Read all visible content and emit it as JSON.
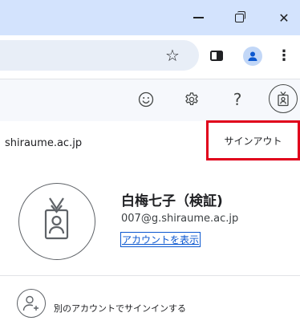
{
  "window": {
    "minimize_icon": "minimize-icon",
    "restore_icon": "restore-icon",
    "close_glyph": "✕"
  },
  "toolbar": {
    "star_glyph": "☆",
    "sidepanel_icon": "side-panel-icon",
    "profile_icon": "profile-icon",
    "menu_glyph": "⋮"
  },
  "gmail_header": {
    "emoji_icon": "emoji-icon",
    "settings_icon": "gear-icon",
    "help_glyph": "?",
    "badge_icon": "id-badge-icon"
  },
  "account": {
    "domain": "shiraume.ac.jp",
    "sign_out_label": "サインアウト",
    "name": "白梅七子（検証)",
    "email": "007@g.shiraume.ac.jp",
    "view_account_label": "アカウントを表示",
    "add_account_label": "別のアカウントでサインインする"
  },
  "colors": {
    "titlebar": "#d3e3fd",
    "highlight_border": "#e0001b",
    "link": "#0b57d0",
    "profile_blue": "#0b57d0"
  }
}
